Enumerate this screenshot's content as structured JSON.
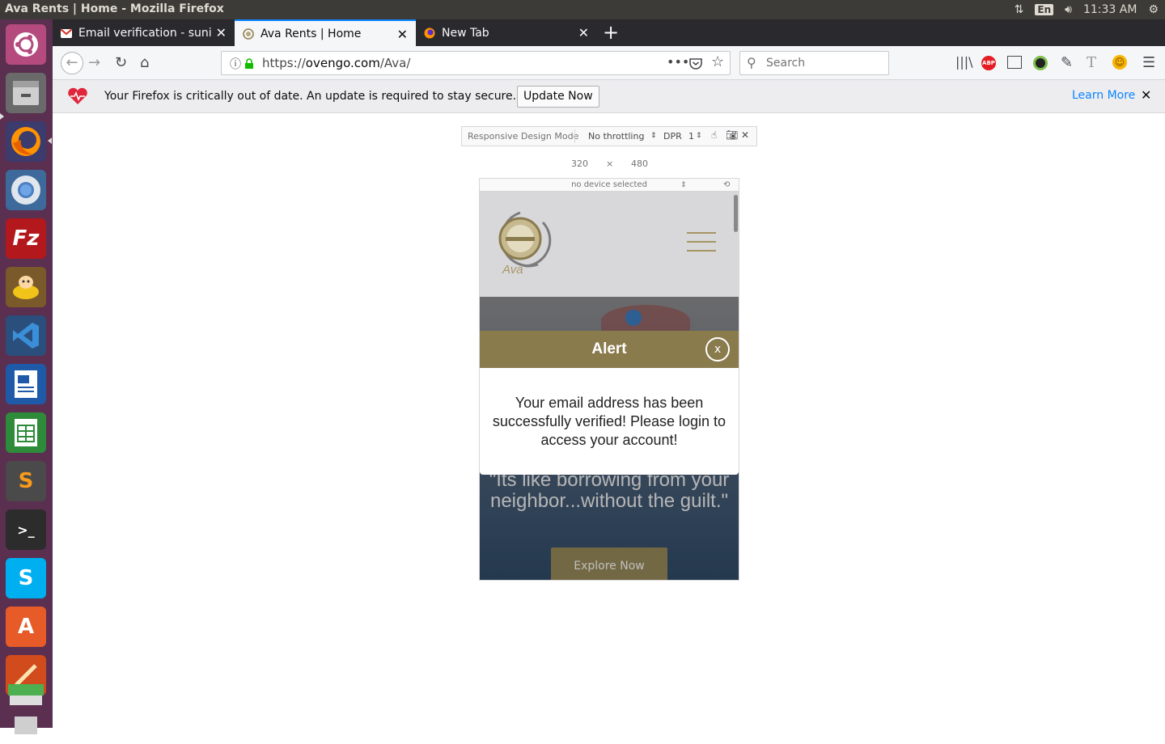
{
  "system": {
    "window_title": "Ava Rents | Home - Mozilla Firefox",
    "keyboard_layout": "En",
    "clock": "11:33 AM"
  },
  "tabs": [
    {
      "label": "Email verification - sunil",
      "favicon": "gmail-icon"
    },
    {
      "label": "Ava Rents | Home",
      "favicon": "ava-icon"
    },
    {
      "label": "New Tab",
      "favicon": "firefox-icon"
    }
  ],
  "nav": {
    "url_prefix": "https://",
    "url_host": "ovengo.com",
    "url_path": "/Ava/",
    "search_placeholder": "Search"
  },
  "notification": {
    "message": "Your Firefox is critically out of date. An update is required to stay secure.",
    "button": "Update Now",
    "link": "Learn More"
  },
  "rdm": {
    "label": "Responsive Design Mode",
    "throttling": "No throttling",
    "dpr_label": "DPR",
    "dpr_value": "1",
    "width": "320",
    "times": "×",
    "height": "480",
    "device": "no device selected"
  },
  "site": {
    "logo_text": "Ava",
    "hero_quote": "\"Its like borrowing from your neighbor...without the guilt.\"",
    "explore_button": "Explore Now"
  },
  "modal": {
    "title": "Alert",
    "close": "x",
    "message": "Your email address has been successfully verified! Please login to access your account!"
  },
  "colors": {
    "brand_gold": "#8a7b4d",
    "launcher_bg": "#5a2f50",
    "link_blue": "#0a84ff"
  }
}
